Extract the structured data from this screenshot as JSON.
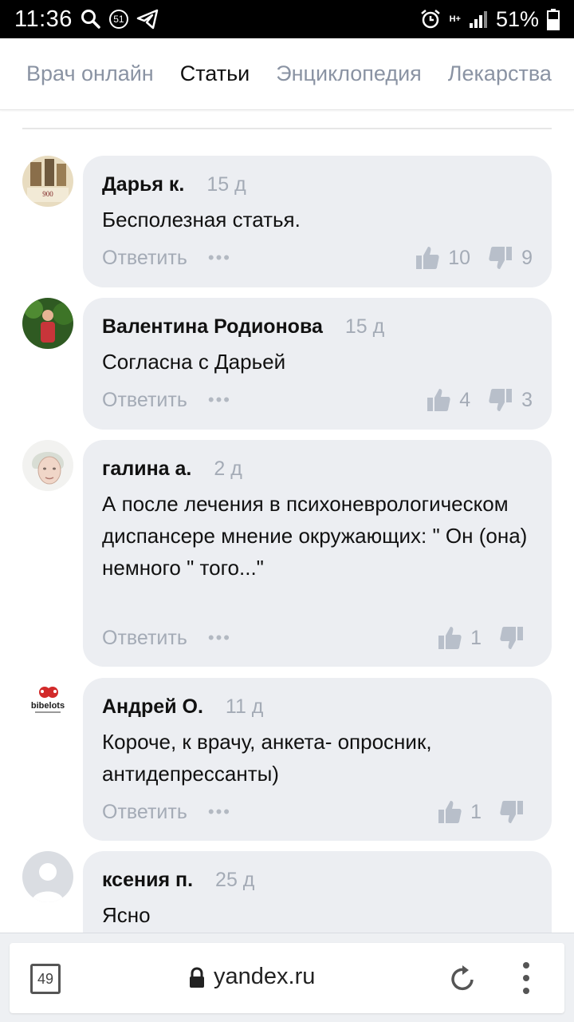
{
  "status_bar": {
    "time": "11:36",
    "notif_count": "51",
    "network": "H+",
    "battery": "51%"
  },
  "nav": {
    "tabs": [
      {
        "label": "Врач онлайн",
        "active": false
      },
      {
        "label": "Статьи",
        "active": true
      },
      {
        "label": "Энциклопедия",
        "active": false
      },
      {
        "label": "Лекарства",
        "active": false
      }
    ]
  },
  "comments": [
    {
      "author": "Дарья к.",
      "date": "15 д",
      "text": "Бесполезная статья.",
      "reply": "Ответить",
      "likes": "10",
      "dislikes": "9"
    },
    {
      "author": "Валентина Родионова",
      "date": "15 д",
      "text": "Согласна с Дарьей",
      "reply": "Ответить",
      "likes": "4",
      "dislikes": "3"
    },
    {
      "author": "галина а.",
      "date": "2 д",
      "text": "А после лечения в психоневрологическом диспансере мнение окружающих: \" Он (она) немного \" того...\"",
      "reply": "Ответить",
      "likes": "1",
      "dislikes": ""
    },
    {
      "author": "Андрей О.",
      "date": "11 д",
      "text": "Короче, к врачу, анкета- опросник, антидепрессанты)",
      "reply": "Ответить",
      "likes": "1",
      "dislikes": ""
    },
    {
      "author": "ксения п.",
      "date": "25 д",
      "text": "Ясно",
      "reply": "",
      "likes": "",
      "dislikes": ""
    }
  ],
  "avatar_texts": {
    "first_avatar_caption": "900",
    "andrey_logo": "bibelots"
  },
  "browser": {
    "tab_count": "49",
    "url": "yandex.ru"
  },
  "colors": {
    "bubble": "#eceef2",
    "muted": "#a4abb6",
    "active_tab": "#111111",
    "inactive_tab": "#8a93a3"
  }
}
